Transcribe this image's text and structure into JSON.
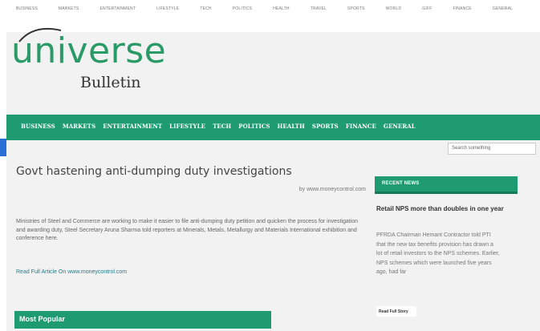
{
  "top_nav": [
    "BUSINESS",
    "MARKETS",
    "ENTERTAINMENT",
    "LIFESTYLE",
    "TECH",
    "POLITICS",
    "HEALTH",
    "TRAVEL",
    "SPORTS",
    "WORLD",
    "GIFF",
    "FINANCE",
    "GENERAL"
  ],
  "logo": {
    "word": "universe",
    "sub": "Bulletin"
  },
  "main_nav": [
    "BUSINESS",
    "MARKETS",
    "ENTERTAINMENT",
    "LIFESTYLE",
    "TECH",
    "POLITICS",
    "HEALTH",
    "SPORTS",
    "FINANCE",
    "GENERAL"
  ],
  "search": {
    "placeholder": "Search something"
  },
  "article": {
    "title": "Govt hastening anti-dumping duty investigations",
    "byline": "by www.moneycontrol.com",
    "body": "Ministries of Steel and Commerce are working to make it easier to file anti-dumping duty petition and quicken the process for investigation and awarding duty, Steel Secretary Aruna Sharma told reporters at Minerals, Metals, Metallurgy and Materials International exhibition and conference here.",
    "read_full": "Read Full Article On www.moneycontrol.com"
  },
  "most_popular": {
    "label": "Most Popular"
  },
  "sidebar": {
    "header": "RECENT NEWS",
    "news_title": "Retail NPS more than doubles in one year",
    "news_body": "PFRDA Chairman Hemant Contractor told PTI that the new tax benefits provision has drawn a lot of retail investors to the NPS schemes. Earlier, NPS schemes which were launched five years ago, had far",
    "read_more": "Read Full Story"
  },
  "colors": {
    "brand_green": "#1e9b70",
    "logo_green": "#2a9a66"
  }
}
